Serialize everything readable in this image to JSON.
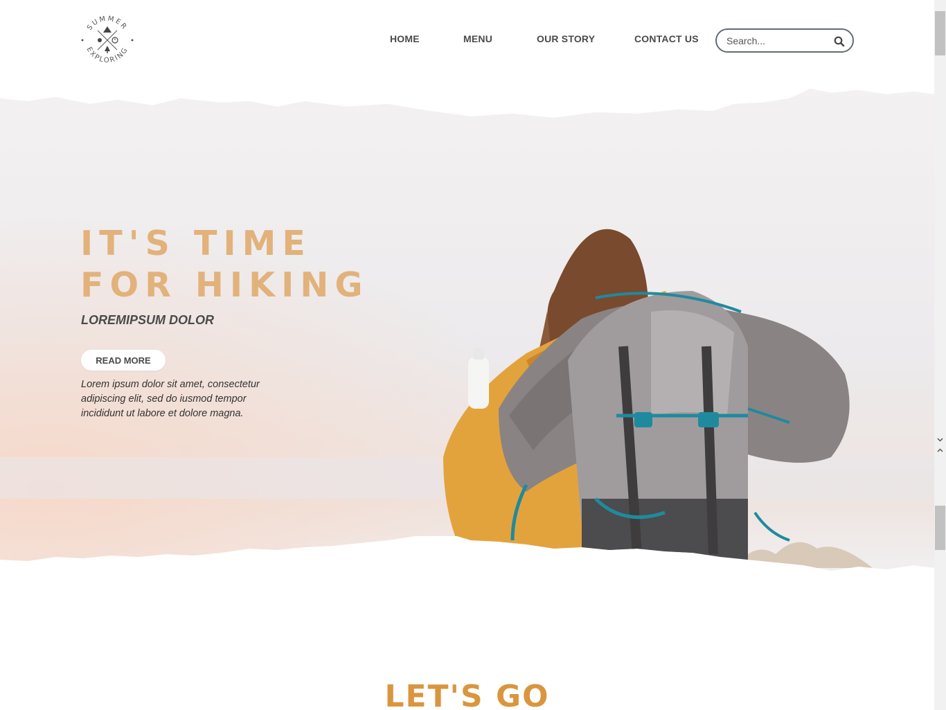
{
  "brand": {
    "logo_top_text": "SUMMER",
    "logo_bottom_text": "EXPLORING"
  },
  "nav": {
    "home": "HOME",
    "menu": "MENU",
    "our_story": "OUR STORY",
    "contact_us": "CONTACT US"
  },
  "search": {
    "placeholder": "Search...",
    "value": ""
  },
  "hero": {
    "title_line1": "IT'S TIME",
    "title_line2": "FOR HIKING",
    "subtitle": "LOREMIPSUM DOLOR",
    "button_label": "READ MORE",
    "body": "Lorem ipsum dolor sit amet, consectetur adipiscing elit, sed do iusmod tempor incididunt ut labore et dolore magna."
  },
  "section": {
    "heading": "LET'S GO"
  },
  "colors": {
    "accent": "#e2b27b",
    "heading_orange": "#d9963f",
    "nav_text": "#4a4a4a",
    "jacket": "#e3a33c",
    "backpack": "#8f8b8d",
    "strap": "#1f8a9e"
  },
  "icons": {
    "search": "magnifier-icon",
    "scroll_down": "chevron-down-icon",
    "scroll_up": "chevron-up-icon"
  }
}
